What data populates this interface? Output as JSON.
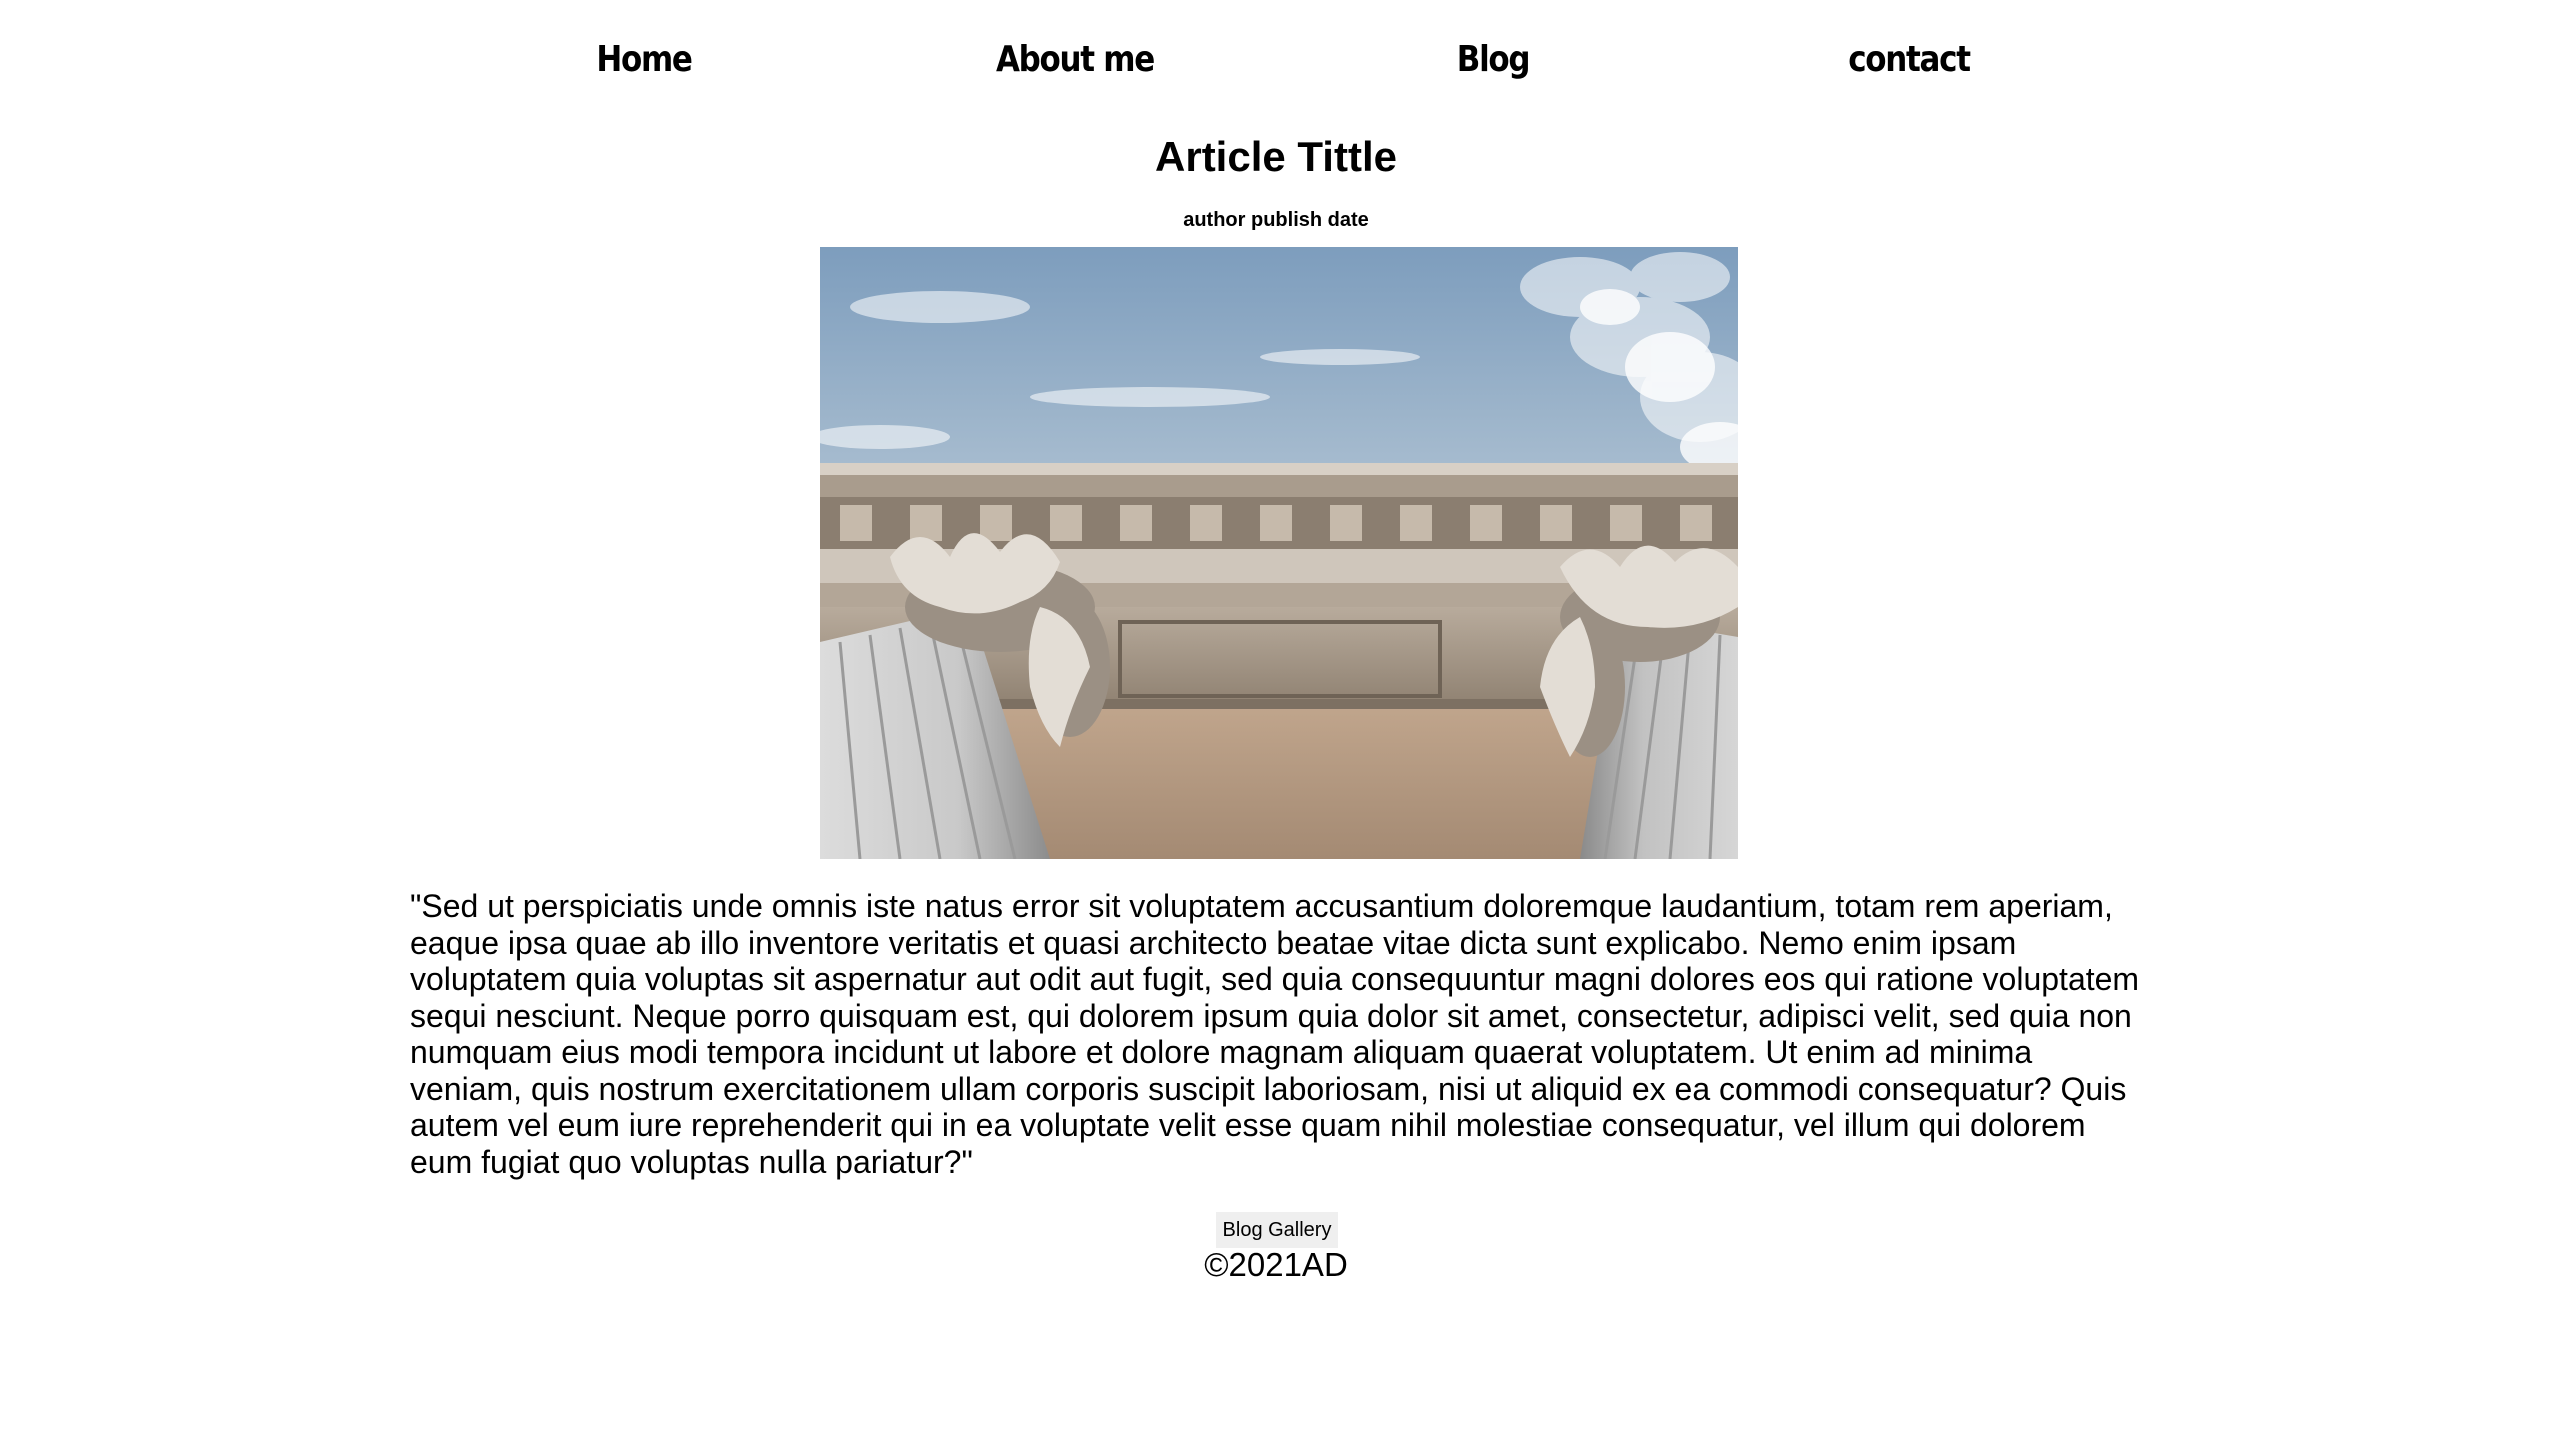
{
  "nav": {
    "items": [
      {
        "label": "Home"
      },
      {
        "label": "About me"
      },
      {
        "label": "Blog"
      },
      {
        "label": "contact"
      }
    ]
  },
  "article": {
    "title": "Article Tittle",
    "meta": "author publish date",
    "image_alt": "Low-angle view of classical Corinthian columns against a cloudy sky",
    "body": "\"Sed ut perspiciatis unde omnis iste natus error sit voluptatem accusantium doloremque laudantium, totam rem aperiam, eaque ipsa quae ab illo inventore veritatis et quasi architecto beatae vitae dicta sunt explicabo. Nemo enim ipsam voluptatem quia voluptas sit aspernatur aut odit aut fugit, sed quia consequuntur magni dolores eos qui ratione voluptatem sequi nesciunt. Neque porro quisquam est, qui dolorem ipsum quia dolor sit amet, consectetur, adipisci velit, sed quia non numquam eius modi tempora incidunt ut labore et dolore magnam aliquam quaerat voluptatem. Ut enim ad minima veniam, quis nostrum exercitationem ullam corporis suscipit laboriosam, nisi ut aliquid ex ea commodi consequatur? Quis autem vel eum iure reprehenderit qui in ea voluptate velit esse quam nihil molestiae consequatur, vel illum qui dolorem eum fugiat quo voluptas nulla pariatur?\""
  },
  "gallery_button": {
    "label": "Blog Gallery"
  },
  "footer": {
    "copyright": "©2021AD"
  }
}
